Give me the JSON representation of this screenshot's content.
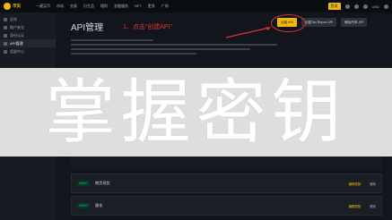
{
  "topbar": {
    "logo_text": "币安",
    "nav": [
      "一键买币",
      "市场",
      "交易",
      "衍生品",
      "理财",
      "金融服务",
      "NFT",
      "更多",
      "广场"
    ],
    "login_label": "登录",
    "language": "USD"
  },
  "sidebar": {
    "items": [
      {
        "label": "总览",
        "active": false
      },
      {
        "label": "账户安全",
        "active": false
      },
      {
        "label": "身份认证",
        "active": false
      },
      {
        "label": "API管理",
        "active": true
      },
      {
        "label": "奖励中心",
        "active": false
      }
    ]
  },
  "main": {
    "title": "API管理",
    "create_button": "创建 API",
    "sub_button_1": "创建Tax Report API",
    "sub_button_2": "删除所有 API"
  },
  "annotation": {
    "text": "1、点击“创建API”",
    "color": "#e03131"
  },
  "banner": {
    "text": "掌握密钥"
  },
  "api_list": [
    {
      "tag": "HMAC",
      "name": "期货现货",
      "edit_label": "编辑限制",
      "delete_label": "删除"
    },
    {
      "tag": "HMAC",
      "name": "量化",
      "edit_label": "编辑限制",
      "delete_label": "删除"
    }
  ],
  "colors": {
    "accent": "#f0b90b",
    "background": "#12161c",
    "annotation_red": "#e03131"
  }
}
